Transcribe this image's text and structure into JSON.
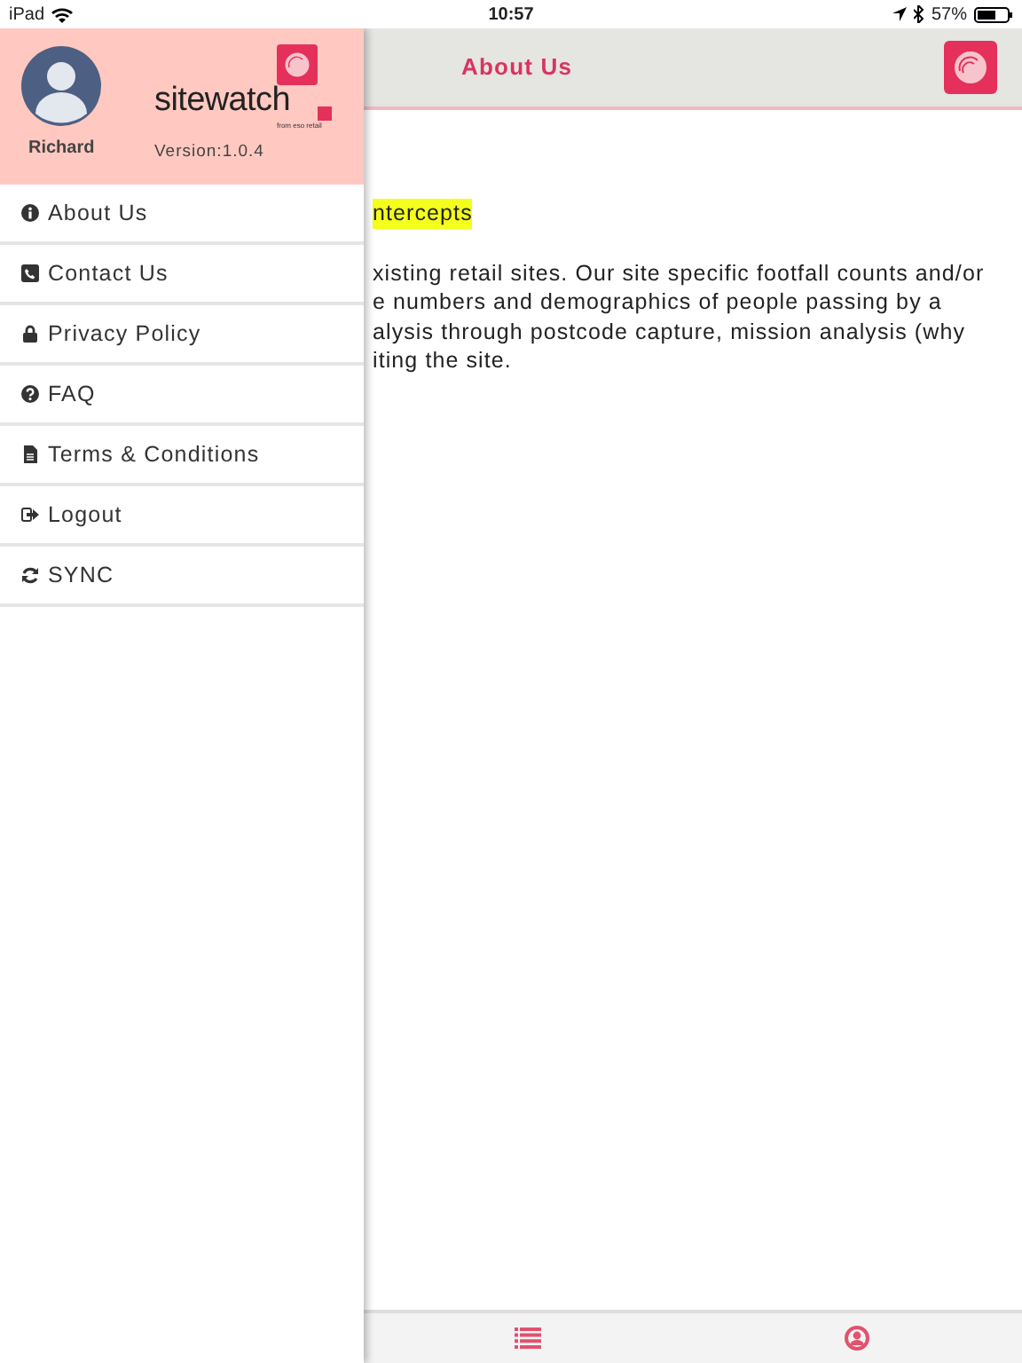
{
  "status_bar": {
    "device": "iPad",
    "time": "10:57",
    "battery": "57%"
  },
  "header": {
    "title": "About Us"
  },
  "content": {
    "highlight": "ntercepts",
    "lines": [
      "xisting retail sites. Our site specific footfall counts and/or",
      "e numbers and demographics of people passing by a",
      "alysis through postcode capture, mission analysis (why",
      "iting the site."
    ]
  },
  "drawer": {
    "user": "Richard",
    "brand": "sitewatch",
    "tagline": "from eso retail",
    "version": "Version:1.0.4",
    "items": [
      {
        "label": "About Us"
      },
      {
        "label": "Contact Us"
      },
      {
        "label": "Privacy Policy"
      },
      {
        "label": "FAQ"
      },
      {
        "label": "Terms & Conditions"
      },
      {
        "label": "Logout"
      },
      {
        "label": "SYNC"
      }
    ]
  }
}
